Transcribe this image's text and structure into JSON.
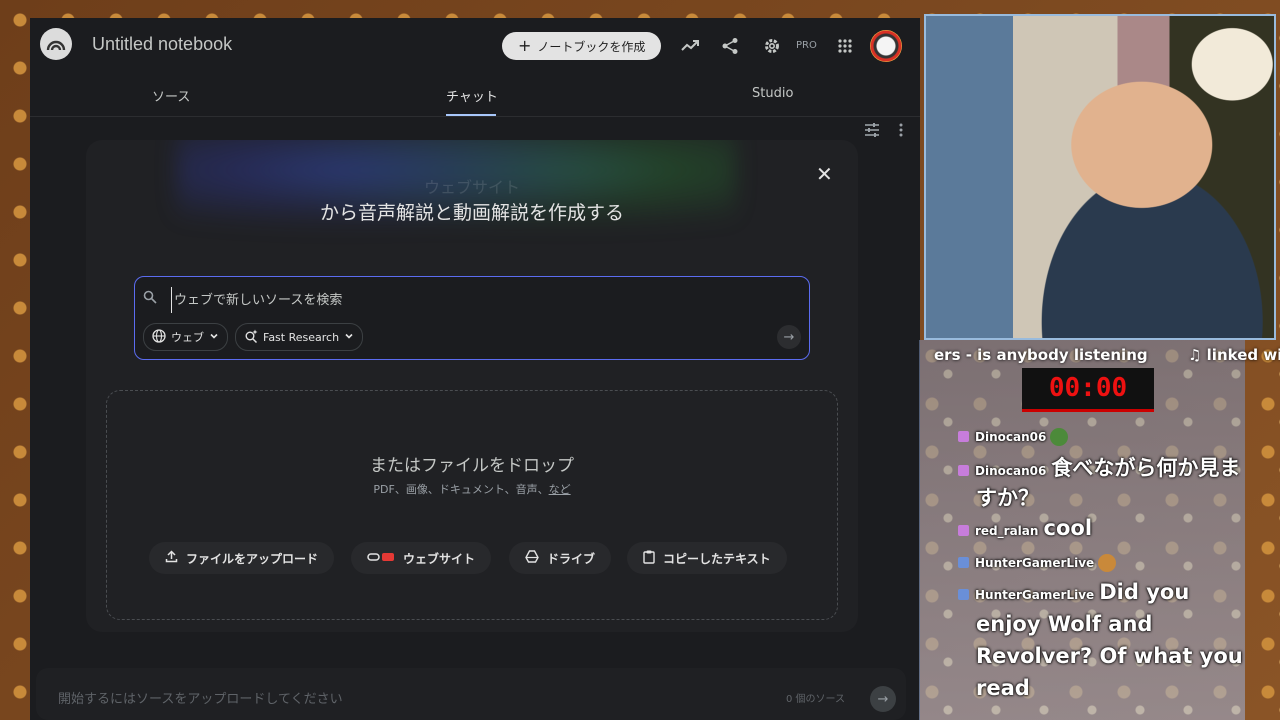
{
  "app": {
    "title": "Untitled notebook",
    "create_button": "ノートブックを作成",
    "pro_label": "PRO",
    "tabs": [
      "ソース",
      "チャット",
      "Studio"
    ]
  },
  "modal": {
    "faded_heading": "ウェブサイト",
    "title": "から音声解説と動画解説を作成する",
    "search": {
      "placeholder": "ウェブで新しいソースを検索",
      "source_chip": "ウェブ",
      "mode_chip": "Fast Research"
    },
    "drop": {
      "title": "またはファイルをドロップ",
      "subtitle": "PDF、画像、ドキュメント、音声、",
      "more_link": "など",
      "buttons": [
        "ファイルをアップロード",
        "ウェブサイト",
        "ドライブ",
        "コピーしたテキスト"
      ]
    }
  },
  "chat_input": {
    "placeholder": "開始するにはソースをアップロードしてください",
    "source_count": "0 個のソース"
  },
  "stream": {
    "ticker": "ers - is anybody listening",
    "now_playing": "♫ linked wi",
    "timer": "00:00",
    "chat": [
      {
        "user": "Dinocan06",
        "message": ""
      },
      {
        "user": "Dinocan06",
        "message": "食べながら何か見ま"
      },
      {
        "user": "",
        "message": "すか？"
      },
      {
        "user": "red_ralan",
        "message": "cool"
      },
      {
        "user": "HunterGamerLive",
        "message": ""
      },
      {
        "user": "HunterGamerLive",
        "message": "Did you"
      },
      {
        "user": "",
        "message": "enjoy Wolf and"
      },
      {
        "user": "",
        "message": "Revolver? Of what you"
      },
      {
        "user": "",
        "message": "read"
      }
    ]
  },
  "colors": {
    "app_bg": "#1b1c1f",
    "accent_border": "#5b6cf0",
    "timer_red": "#e11111"
  },
  "icons": [
    "notebooklm-logo-icon",
    "analytics-icon",
    "share-icon",
    "settings-icon",
    "apps-grid-icon",
    "avatar",
    "tune-icon",
    "more-vert-icon",
    "close-icon",
    "search-icon",
    "globe-icon",
    "sparkle-search-icon",
    "chevron-down-icon",
    "arrow-right-icon",
    "upload-icon",
    "link-icon",
    "drive-icon",
    "clipboard-icon"
  ]
}
